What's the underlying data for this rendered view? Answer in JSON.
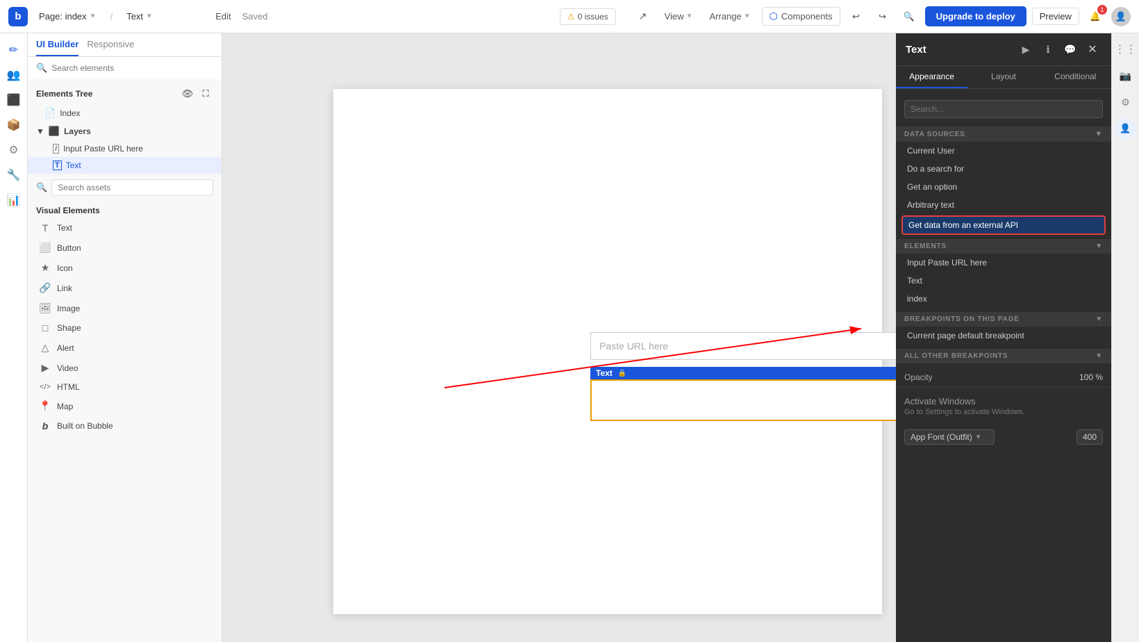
{
  "topbar": {
    "logo_letter": "b",
    "page_label": "Page: index",
    "element_label": "Text",
    "edit_label": "Edit",
    "saved_label": "Saved",
    "issues_label": "0 issues",
    "view_label": "View",
    "arrange_label": "Arrange",
    "components_label": "Components",
    "upgrade_label": "Upgrade to deploy",
    "preview_label": "Preview",
    "notif_count": "1"
  },
  "left_nav": {
    "icons": [
      "✏️",
      "👥",
      "🗂️",
      "📦",
      "⚙️",
      "🔧",
      "📊"
    ]
  },
  "left_panel": {
    "tabs": [
      {
        "label": "UI Builder",
        "active": true
      },
      {
        "label": "Responsive",
        "active": false
      }
    ],
    "search_placeholder": "Search elements",
    "elements_tree_label": "Elements Tree",
    "tree_items": [
      {
        "type": "page",
        "label": "Index",
        "icon": "📄",
        "indent": 0
      },
      {
        "type": "folder",
        "label": "Layers",
        "icon": "▼",
        "indent": 0
      },
      {
        "type": "input",
        "label": "Input Paste URL here",
        "icon": "I",
        "indent": 1
      },
      {
        "type": "text",
        "label": "Text",
        "icon": "T",
        "indent": 1,
        "selected": true
      }
    ],
    "search_assets_placeholder": "Search assets",
    "visual_elements_label": "Visual Elements",
    "elements": [
      {
        "icon": "T",
        "label": "Text"
      },
      {
        "icon": "⬜",
        "label": "Button"
      },
      {
        "icon": "★",
        "label": "Icon"
      },
      {
        "icon": "🔗",
        "label": "Link"
      },
      {
        "icon": "🖼",
        "label": "Image"
      },
      {
        "icon": "□",
        "label": "Shape"
      },
      {
        "icon": "△",
        "label": "Alert"
      },
      {
        "icon": "▶",
        "label": "Video"
      },
      {
        "icon": "</>",
        "label": "HTML"
      },
      {
        "icon": "📍",
        "label": "Map"
      },
      {
        "icon": "b",
        "label": "Built on Bubble"
      }
    ]
  },
  "canvas": {
    "input_placeholder": "Paste URL here",
    "text_label": "Text",
    "text_icon": "🔒"
  },
  "right_panel": {
    "title": "Text",
    "tabs": [
      {
        "label": "Appearance",
        "active": true
      },
      {
        "label": "Layout",
        "active": false
      },
      {
        "label": "Conditional",
        "active": false
      }
    ],
    "search_placeholder": "Search...",
    "sections": {
      "data_sources_label": "DATA SOURCES",
      "data_sources_items": [
        {
          "label": "Current User",
          "highlighted": false
        },
        {
          "label": "Do a search for",
          "highlighted": false
        },
        {
          "label": "Get an option",
          "highlighted": false
        },
        {
          "label": "Arbitrary text",
          "highlighted": false
        },
        {
          "label": "Get data from an external API",
          "highlighted": true
        }
      ],
      "elements_label": "ELEMENTS",
      "elements_items": [
        {
          "label": "Input Paste URL here"
        },
        {
          "label": "Text"
        },
        {
          "label": "index"
        }
      ],
      "breakpoints_label": "BREAKPOINTS ON THIS PAGE",
      "breakpoints_items": [
        {
          "label": "Current page default breakpoint"
        }
      ],
      "all_other_label": "ALL OTHER BREAKPOINTS"
    },
    "opacity_label": "Opacity",
    "opacity_value": "100 %",
    "activate_windows": "Activate Windows",
    "activate_windows_sub": "Go to Settings to activate Windows.",
    "font_label": "App Font (Outfit)",
    "font_weight": "400"
  }
}
